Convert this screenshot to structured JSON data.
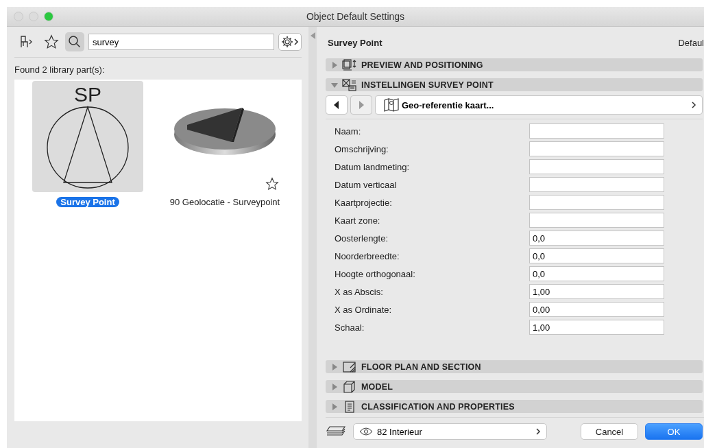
{
  "window": {
    "title": "Object Default Settings"
  },
  "search": {
    "value": "survey"
  },
  "found_label": "Found 2 library part(s):",
  "library_items": [
    {
      "kind": "symbol",
      "symbol": "SP",
      "label": "Survey Point",
      "selected": true
    },
    {
      "kind": "model",
      "label": "90 Geolocatie - Surveypoint",
      "selected": false
    }
  ],
  "object_name": "Survey Point",
  "default_label": "Defaul",
  "sections_top": [
    {
      "kind": "preview",
      "title": "PREVIEW AND POSITIONING",
      "expanded": false
    },
    {
      "kind": "settings",
      "title": "INSTELLINGEN SURVEY POINT",
      "expanded": true
    }
  ],
  "page_nav": {
    "prev_disabled": false,
    "next_disabled": true,
    "page": "Geo-referentie kaart..."
  },
  "parameters": [
    {
      "label": "Naam:"
    },
    {
      "label": "Omschrijving:"
    },
    {
      "label": "Datum landmeting:"
    },
    {
      "label": "Datum verticaal"
    },
    {
      "label": "Kaartprojectie:"
    },
    {
      "label": "Kaart zone:"
    },
    {
      "label": "Oosterlengte:",
      "value": "0,0"
    },
    {
      "label": "Noorderbreedte:",
      "value": "0,0"
    },
    {
      "label": "Hoogte orthogonaal:",
      "value": "0,0"
    },
    {
      "label": "X as Abscis:",
      "value": "1,00"
    },
    {
      "label": "X as Ordinate:",
      "value": "0,00"
    },
    {
      "label": "Schaal:",
      "value": "1,00"
    }
  ],
  "sections_bottom": [
    {
      "kind": "floorplan",
      "title": "FLOOR PLAN AND SECTION",
      "expanded": false
    },
    {
      "kind": "model",
      "title": "MODEL",
      "expanded": false
    },
    {
      "kind": "classification",
      "title": "CLASSIFICATION AND PROPERTIES",
      "expanded": false
    }
  ],
  "layer": {
    "value": "82 Interieur"
  },
  "buttons": {
    "cancel": "Cancel",
    "ok": "OK"
  }
}
